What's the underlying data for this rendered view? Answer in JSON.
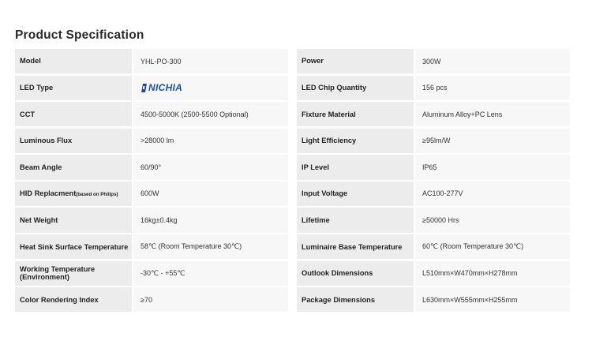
{
  "title": "Product Specification",
  "left": [
    {
      "label": "Model",
      "value": "YHL-PO-300"
    },
    {
      "label": "LED Type",
      "value": "NICHIA"
    },
    {
      "label": "CCT",
      "value": "4500-5000K (2500-5500 Optional)"
    },
    {
      "label": "Luminous Flux",
      "value": ">28000 lm"
    },
    {
      "label": "Beam Angle",
      "value": "60/90°"
    },
    {
      "label": "HID Replacment",
      "label_note": "(based on Philips)",
      "value": "600W"
    },
    {
      "label": "Net Weight",
      "value": "16kg±0.4kg"
    },
    {
      "label": "Heat Sink Surface Temperature",
      "value": "58℃ (Room Temperature 30℃)"
    },
    {
      "label": "Working Temperature (Environment)",
      "value": "-30℃ - +55℃"
    },
    {
      "label": "Color Rendering Index",
      "value": "≥70"
    }
  ],
  "right": [
    {
      "label": "Power",
      "value": "300W"
    },
    {
      "label": "LED Chip Quantity",
      "value": "156 pcs"
    },
    {
      "label": "Fixture Material",
      "value": "Aluminum Alloy+PC Lens"
    },
    {
      "label": "Light Efficiency",
      "value": "≥95lm/W"
    },
    {
      "label": "IP Level",
      "value": "IP65"
    },
    {
      "label": "Input Voltage",
      "value": "AC100-277V"
    },
    {
      "label": "Lifetime",
      "value": "≥50000 Hrs"
    },
    {
      "label": "Luminaire Base Temperature",
      "value": "60℃ (Room Temperature 30℃)"
    },
    {
      "label": "Outlook Dimensions",
      "value": "L510mm×W470mm×H278mm"
    },
    {
      "label": "Package Dimensions",
      "value": "L630mm×W555mm×H255mm"
    }
  ],
  "colors": {
    "brand_logo": "#1c4f9c",
    "label_bg": "#ececec",
    "value_bg": "#f7f7f7"
  },
  "icons": {
    "led_type_logo": "nichia-logo"
  }
}
